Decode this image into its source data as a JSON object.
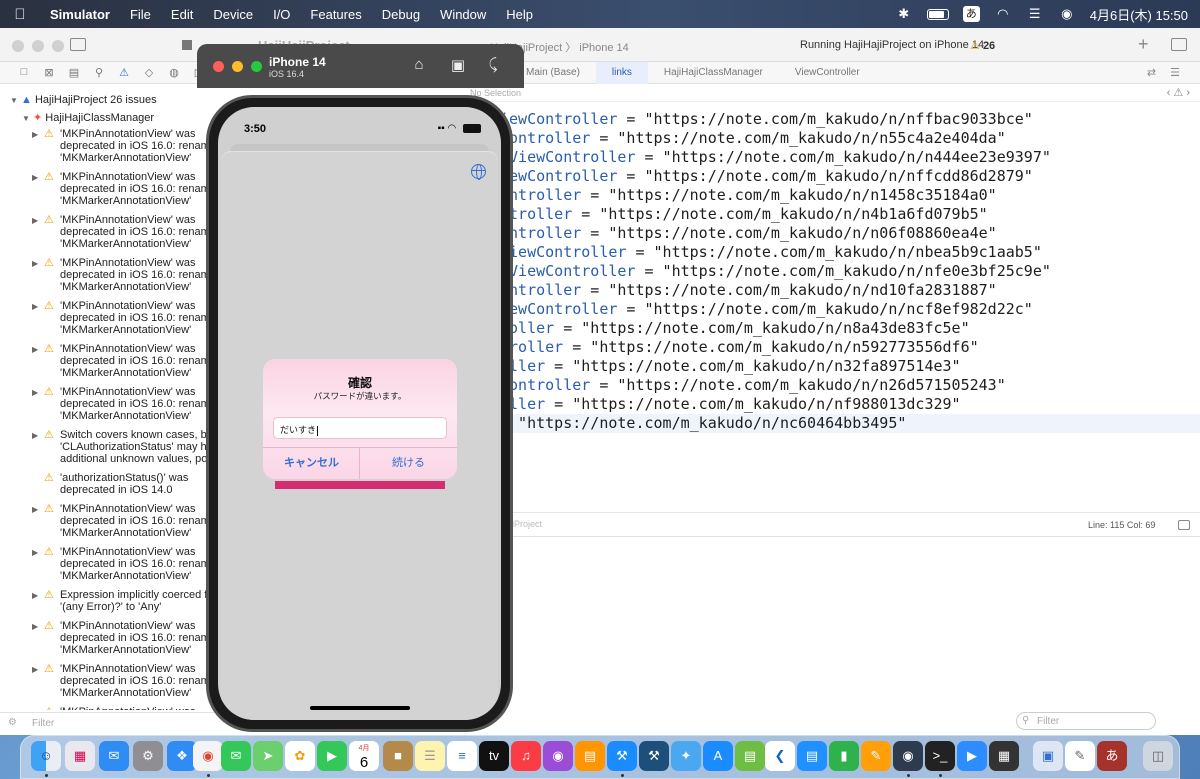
{
  "menubar": {
    "apple": "",
    "items": [
      "Simulator",
      "File",
      "Edit",
      "Device",
      "I/O",
      "Features",
      "Debug",
      "Window",
      "Help"
    ],
    "ime": "あ",
    "datetime": "4月6日(木) 15:50"
  },
  "xcode": {
    "project_title": "HajiHajiProject",
    "scheme": "HajiHajiProject 〉 iPhone 14",
    "status": "Running HajiHajiProject on iPhone 14",
    "warning_count": "26",
    "tabs": [
      "Main (Base)",
      "links",
      "HajiHajiClassManager",
      "ViewController"
    ],
    "active_tab": "links",
    "jumpbar": "No Selection",
    "navigator": {
      "root": "HajiHajiProject 26 issues",
      "group": "HajiHajiClassManager",
      "issues": [
        [
          "'MKPinAnnotationView' was",
          "deprecated in iOS 16.0: renamed to",
          "'MKMarkerAnnotationView'"
        ],
        [
          "'MKPinAnnotationView' was",
          "deprecated in iOS 16.0: renamed to",
          "'MKMarkerAnnotationView'"
        ],
        [
          "'MKPinAnnotationView' was",
          "deprecated in iOS 16.0: renamed to",
          "'MKMarkerAnnotationView'"
        ],
        [
          "'MKPinAnnotationView' was",
          "deprecated in iOS 16.0: renamed to",
          "'MKMarkerAnnotationView'"
        ],
        [
          "'MKPinAnnotationView' was",
          "deprecated in iOS 16.0: renamed to",
          "'MKMarkerAnnotationView'"
        ],
        [
          "'MKPinAnnotationView' was",
          "deprecated in iOS 16.0: renamed to",
          "'MKMarkerAnnotationView'"
        ],
        [
          "'MKPinAnnotationView' was",
          "deprecated in iOS 16.0: renamed to",
          "'MKMarkerAnnotationView'"
        ],
        [
          "Switch covers known cases, but",
          "'CLAuthorizationStatus' may have",
          "additional unknown values, possibly"
        ],
        [
          "'authorizationStatus()' was",
          "deprecated in iOS 14.0"
        ],
        [
          "'MKPinAnnotationView' was",
          "deprecated in iOS 16.0: renamed to",
          "'MKMarkerAnnotationView'"
        ],
        [
          "'MKPinAnnotationView' was",
          "deprecated in iOS 16.0: renamed to",
          "'MKMarkerAnnotationView'"
        ],
        [
          "Expression implicitly coerced from",
          "'(any Error)?' to 'Any'"
        ],
        [
          "'MKPinAnnotationView' was",
          "deprecated in iOS 16.0: renamed to",
          "'MKMarkerAnnotationView'"
        ],
        [
          "'MKPinAnnotationView' was",
          "deprecated in iOS 16.0: renamed to",
          "'MKMarkerAnnotationView'"
        ],
        [
          "'MKPinAnnotationView' was"
        ]
      ],
      "filter_placeholder": "Filter"
    },
    "code_lines": [
      {
        "id": "iewController",
        "rest": " = \"https://note.com/m_kakudo/n/nffbac9033bce\""
      },
      {
        "id": "Controller",
        "rest": " = \"https://note.com/m_kakudo/n/n55c4a2e404da\""
      },
      {
        "id": "dViewController",
        "rest": " = \"https://note.com/m_kakudo/n/n444ee23e9397\""
      },
      {
        "id": "iewController",
        "rest": " = \"https://note.com/m_kakudo/n/nffcdd86d2879\""
      },
      {
        "id": "ontroller",
        "rest": " = \"https://note.com/m_kakudo/n/n1458c35184a0\""
      },
      {
        "id": "ntroller",
        "rest": " = \"https://note.com/m_kakudo/n/n4b1a6fd079b5\""
      },
      {
        "id": "ontroller",
        "rest": " = \"https://note.com/m_kakudo/n/n06f08860ea4e\""
      },
      {
        "id": "ViewController",
        "rest": " = \"https://note.com/m_kakudo/n/nbea5b9c1aab5\""
      },
      {
        "id": "nViewController",
        "rest": " = \"https://note.com/m_kakudo/n/nfe0e3bf25c9e\""
      },
      {
        "id": "ontroller",
        "rest": " = \"https://note.com/m_kakudo/n/nd10fa2831887\""
      },
      {
        "id": "iewController",
        "rest": " = \"https://note.com/m_kakudo/n/ncf8ef982d22c\""
      },
      {
        "id": "roller",
        "rest": " = \"https://note.com/m_kakudo/n/n8a43de83fc5e\""
      },
      {
        "id": "troller",
        "rest": " = \"https://note.com/m_kakudo/n/n592773556df6\""
      },
      {
        "id": "oller",
        "rest": " = \"https://note.com/m_kakudo/n/n32fa897514e3\""
      },
      {
        "id": "Controller",
        "rest": " = \"https://note.com/m_kakudo/n/n26d571505243\""
      },
      {
        "id": "oller",
        "rest": " = \"https://note.com/m_kakudo/n/nf988013dc329\""
      },
      {
        "id": "",
        "rest": "= \"https://note.com/m_kakudo/n/nc60464bb3495\""
      }
    ],
    "current_line_index": 16,
    "debug_label": "iProject",
    "line_col": "Line: 115  Col: 69",
    "right_filter_placeholder": "Filter"
  },
  "simulator": {
    "device": "iPhone 14",
    "os": "iOS 16.4",
    "status_time": "3:50",
    "alert": {
      "title": "確認",
      "message": "パスワードが違います。",
      "input_value": "だいすき",
      "cancel_label": "キャンセル",
      "ok_label": "続ける"
    }
  },
  "dock": {
    "calendar_month": "4月",
    "calendar_day": "6"
  },
  "colors": {
    "accent": "#2f6fd6",
    "alert_bg": "#fde8f1",
    "pink_bar": "#d52d72",
    "warning": "#e2a500"
  }
}
